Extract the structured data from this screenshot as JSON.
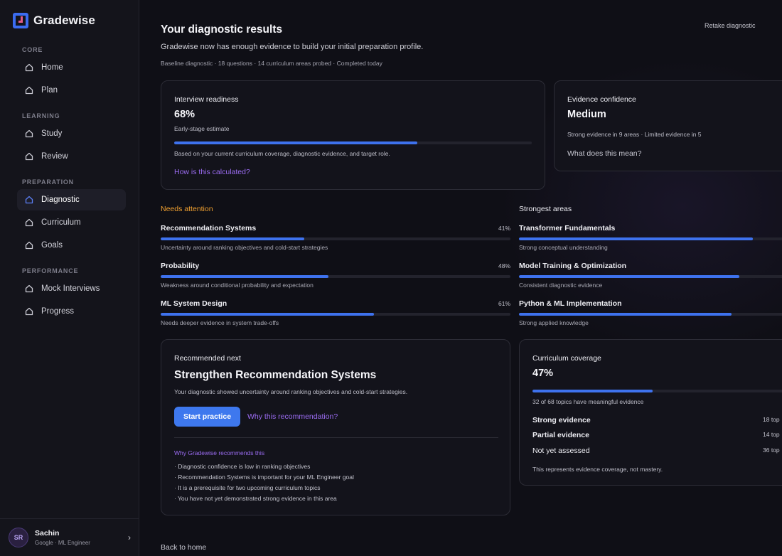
{
  "brand": {
    "name": "Gradewise"
  },
  "nav": {
    "sections": [
      {
        "title": "CORE",
        "items": [
          "Home",
          "Plan"
        ]
      },
      {
        "title": "LEARNING",
        "items": [
          "Study",
          "Review"
        ]
      },
      {
        "title": "PREPARATION",
        "items": [
          "Diagnostic",
          "Curriculum",
          "Goals"
        ]
      },
      {
        "title": "PERFORMANCE",
        "items": [
          "Mock Interviews",
          "Progress"
        ]
      }
    ],
    "active": "Diagnostic"
  },
  "user": {
    "initials": "SR",
    "name": "Sachin",
    "role": "Google · ML Engineer"
  },
  "header": {
    "title": "Your diagnostic results",
    "retake": "Retake diagnostic",
    "subtitle": "Gradewise now has enough evidence to build your initial preparation profile.",
    "meta": "Baseline diagnostic · 18 questions · 14 curriculum areas probed · Completed today"
  },
  "readiness": {
    "label": "Interview readiness",
    "value": "68%",
    "fraction": 0.68,
    "caption": "Early-stage estimate",
    "basis": "Based on your current curriculum coverage, diagnostic evidence, and target role.",
    "link": "How is this calculated?"
  },
  "confidence": {
    "label": "Evidence confidence",
    "value": "Medium",
    "detail": "Strong evidence in 9 areas · Limited evidence in 5",
    "link": "What does this mean?"
  },
  "needs_attention": {
    "title": "Needs attention",
    "color": "#f0a030",
    "items": [
      {
        "name": "Recommendation Systems",
        "pct": "41%",
        "fraction": 0.41,
        "note": "Uncertainty around ranking objectives and cold-start strategies"
      },
      {
        "name": "Probability",
        "pct": "48%",
        "fraction": 0.48,
        "note": "Weakness around conditional probability and expectation"
      },
      {
        "name": "ML System Design",
        "pct": "61%",
        "fraction": 0.61,
        "note": "Needs deeper evidence in system trade-offs"
      }
    ]
  },
  "strongest": {
    "title": "Strongest areas",
    "items": [
      {
        "name": "Transformer Fundamentals",
        "fraction": 0.88,
        "note": "Strong conceptual understanding"
      },
      {
        "name": "Model Training & Optimization",
        "fraction": 0.83,
        "note": "Consistent diagnostic evidence"
      },
      {
        "name": "Python & ML Implementation",
        "fraction": 0.8,
        "note": "Strong applied knowledge"
      }
    ]
  },
  "recommended": {
    "label": "Recommended next",
    "title": "Strengthen Recommendation Systems",
    "desc": "Your diagnostic showed uncertainty around ranking objectives and cold-start strategies.",
    "primary": "Start practice",
    "secondary": "Why this recommendation?",
    "why_title": "Why Gradewise recommends this",
    "reasons": [
      "· Diagnostic confidence is low in ranking objectives",
      "· Recommendation Systems is important for your ML Engineer goal",
      "· It is a prerequisite for two upcoming curriculum topics",
      "· You have not yet demonstrated strong evidence in this area"
    ]
  },
  "coverage": {
    "label": "Curriculum coverage",
    "value": "47%",
    "fraction": 0.47,
    "caption": "32 of 68 topics have meaningful evidence",
    "rows": [
      {
        "label": "Strong evidence",
        "value": "18 top"
      },
      {
        "label": "Partial evidence",
        "value": "14 top"
      },
      {
        "label": "Not yet assessed",
        "value": "36 top"
      }
    ],
    "footnote": "This represents evidence coverage, not mastery."
  },
  "footer": {
    "back": "Back to home"
  }
}
